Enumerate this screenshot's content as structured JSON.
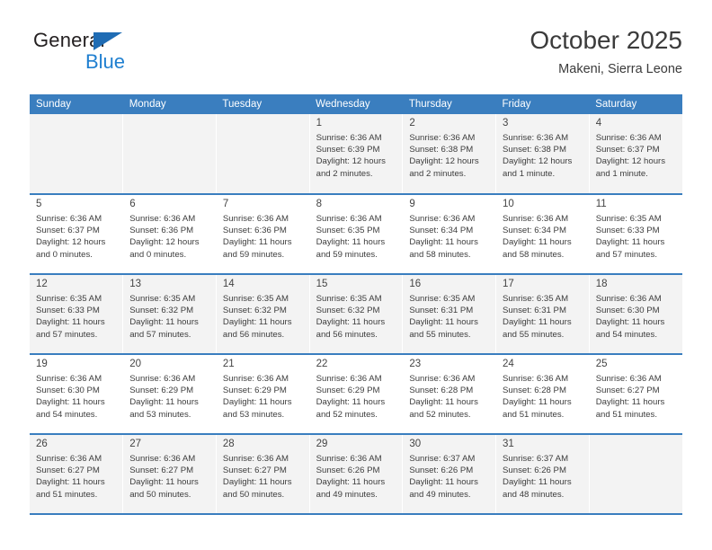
{
  "brand": {
    "line1": "General",
    "line2": "Blue",
    "triangle_icon": "blue-triangle-logo-mark",
    "color_dark": "#231f20",
    "color_blue": "#1f7fd0",
    "triangle_color": "#1f6cb4"
  },
  "header": {
    "title": "October 2025",
    "subtitle": "Makeni, Sierra Leone"
  },
  "theme": {
    "header_row_bg": "#3a7ebf",
    "header_row_text": "#ffffff",
    "row_shaded_bg": "#f3f3f3",
    "row_plain_bg": "#ffffff",
    "cell_text": "#3d3d3d",
    "daynum_text": "#444444"
  },
  "weekday_headers": [
    "Sunday",
    "Monday",
    "Tuesday",
    "Wednesday",
    "Thursday",
    "Friday",
    "Saturday"
  ],
  "labels": {
    "sunrise": "Sunrise:",
    "sunset": "Sunset:",
    "daylight": "Daylight:"
  },
  "weeks": [
    [
      {
        "day": "",
        "sunrise": "",
        "sunset": "",
        "daylight_l1": "",
        "daylight_l2": "",
        "blank": true
      },
      {
        "day": "",
        "sunrise": "",
        "sunset": "",
        "daylight_l1": "",
        "daylight_l2": "",
        "blank": true
      },
      {
        "day": "",
        "sunrise": "",
        "sunset": "",
        "daylight_l1": "",
        "daylight_l2": "",
        "blank": true
      },
      {
        "day": "1",
        "sunrise": "Sunrise: 6:36 AM",
        "sunset": "Sunset: 6:39 PM",
        "daylight_l1": "Daylight: 12 hours",
        "daylight_l2": "and 2 minutes.",
        "blank": false
      },
      {
        "day": "2",
        "sunrise": "Sunrise: 6:36 AM",
        "sunset": "Sunset: 6:38 PM",
        "daylight_l1": "Daylight: 12 hours",
        "daylight_l2": "and 2 minutes.",
        "blank": false
      },
      {
        "day": "3",
        "sunrise": "Sunrise: 6:36 AM",
        "sunset": "Sunset: 6:38 PM",
        "daylight_l1": "Daylight: 12 hours",
        "daylight_l2": "and 1 minute.",
        "blank": false
      },
      {
        "day": "4",
        "sunrise": "Sunrise: 6:36 AM",
        "sunset": "Sunset: 6:37 PM",
        "daylight_l1": "Daylight: 12 hours",
        "daylight_l2": "and 1 minute.",
        "blank": false
      }
    ],
    [
      {
        "day": "5",
        "sunrise": "Sunrise: 6:36 AM",
        "sunset": "Sunset: 6:37 PM",
        "daylight_l1": "Daylight: 12 hours",
        "daylight_l2": "and 0 minutes.",
        "blank": false
      },
      {
        "day": "6",
        "sunrise": "Sunrise: 6:36 AM",
        "sunset": "Sunset: 6:36 PM",
        "daylight_l1": "Daylight: 12 hours",
        "daylight_l2": "and 0 minutes.",
        "blank": false
      },
      {
        "day": "7",
        "sunrise": "Sunrise: 6:36 AM",
        "sunset": "Sunset: 6:36 PM",
        "daylight_l1": "Daylight: 11 hours",
        "daylight_l2": "and 59 minutes.",
        "blank": false
      },
      {
        "day": "8",
        "sunrise": "Sunrise: 6:36 AM",
        "sunset": "Sunset: 6:35 PM",
        "daylight_l1": "Daylight: 11 hours",
        "daylight_l2": "and 59 minutes.",
        "blank": false
      },
      {
        "day": "9",
        "sunrise": "Sunrise: 6:36 AM",
        "sunset": "Sunset: 6:34 PM",
        "daylight_l1": "Daylight: 11 hours",
        "daylight_l2": "and 58 minutes.",
        "blank": false
      },
      {
        "day": "10",
        "sunrise": "Sunrise: 6:36 AM",
        "sunset": "Sunset: 6:34 PM",
        "daylight_l1": "Daylight: 11 hours",
        "daylight_l2": "and 58 minutes.",
        "blank": false
      },
      {
        "day": "11",
        "sunrise": "Sunrise: 6:35 AM",
        "sunset": "Sunset: 6:33 PM",
        "daylight_l1": "Daylight: 11 hours",
        "daylight_l2": "and 57 minutes.",
        "blank": false
      }
    ],
    [
      {
        "day": "12",
        "sunrise": "Sunrise: 6:35 AM",
        "sunset": "Sunset: 6:33 PM",
        "daylight_l1": "Daylight: 11 hours",
        "daylight_l2": "and 57 minutes.",
        "blank": false
      },
      {
        "day": "13",
        "sunrise": "Sunrise: 6:35 AM",
        "sunset": "Sunset: 6:32 PM",
        "daylight_l1": "Daylight: 11 hours",
        "daylight_l2": "and 57 minutes.",
        "blank": false
      },
      {
        "day": "14",
        "sunrise": "Sunrise: 6:35 AM",
        "sunset": "Sunset: 6:32 PM",
        "daylight_l1": "Daylight: 11 hours",
        "daylight_l2": "and 56 minutes.",
        "blank": false
      },
      {
        "day": "15",
        "sunrise": "Sunrise: 6:35 AM",
        "sunset": "Sunset: 6:32 PM",
        "daylight_l1": "Daylight: 11 hours",
        "daylight_l2": "and 56 minutes.",
        "blank": false
      },
      {
        "day": "16",
        "sunrise": "Sunrise: 6:35 AM",
        "sunset": "Sunset: 6:31 PM",
        "daylight_l1": "Daylight: 11 hours",
        "daylight_l2": "and 55 minutes.",
        "blank": false
      },
      {
        "day": "17",
        "sunrise": "Sunrise: 6:35 AM",
        "sunset": "Sunset: 6:31 PM",
        "daylight_l1": "Daylight: 11 hours",
        "daylight_l2": "and 55 minutes.",
        "blank": false
      },
      {
        "day": "18",
        "sunrise": "Sunrise: 6:36 AM",
        "sunset": "Sunset: 6:30 PM",
        "daylight_l1": "Daylight: 11 hours",
        "daylight_l2": "and 54 minutes.",
        "blank": false
      }
    ],
    [
      {
        "day": "19",
        "sunrise": "Sunrise: 6:36 AM",
        "sunset": "Sunset: 6:30 PM",
        "daylight_l1": "Daylight: 11 hours",
        "daylight_l2": "and 54 minutes.",
        "blank": false
      },
      {
        "day": "20",
        "sunrise": "Sunrise: 6:36 AM",
        "sunset": "Sunset: 6:29 PM",
        "daylight_l1": "Daylight: 11 hours",
        "daylight_l2": "and 53 minutes.",
        "blank": false
      },
      {
        "day": "21",
        "sunrise": "Sunrise: 6:36 AM",
        "sunset": "Sunset: 6:29 PM",
        "daylight_l1": "Daylight: 11 hours",
        "daylight_l2": "and 53 minutes.",
        "blank": false
      },
      {
        "day": "22",
        "sunrise": "Sunrise: 6:36 AM",
        "sunset": "Sunset: 6:29 PM",
        "daylight_l1": "Daylight: 11 hours",
        "daylight_l2": "and 52 minutes.",
        "blank": false
      },
      {
        "day": "23",
        "sunrise": "Sunrise: 6:36 AM",
        "sunset": "Sunset: 6:28 PM",
        "daylight_l1": "Daylight: 11 hours",
        "daylight_l2": "and 52 minutes.",
        "blank": false
      },
      {
        "day": "24",
        "sunrise": "Sunrise: 6:36 AM",
        "sunset": "Sunset: 6:28 PM",
        "daylight_l1": "Daylight: 11 hours",
        "daylight_l2": "and 51 minutes.",
        "blank": false
      },
      {
        "day": "25",
        "sunrise": "Sunrise: 6:36 AM",
        "sunset": "Sunset: 6:27 PM",
        "daylight_l1": "Daylight: 11 hours",
        "daylight_l2": "and 51 minutes.",
        "blank": false
      }
    ],
    [
      {
        "day": "26",
        "sunrise": "Sunrise: 6:36 AM",
        "sunset": "Sunset: 6:27 PM",
        "daylight_l1": "Daylight: 11 hours",
        "daylight_l2": "and 51 minutes.",
        "blank": false
      },
      {
        "day": "27",
        "sunrise": "Sunrise: 6:36 AM",
        "sunset": "Sunset: 6:27 PM",
        "daylight_l1": "Daylight: 11 hours",
        "daylight_l2": "and 50 minutes.",
        "blank": false
      },
      {
        "day": "28",
        "sunrise": "Sunrise: 6:36 AM",
        "sunset": "Sunset: 6:27 PM",
        "daylight_l1": "Daylight: 11 hours",
        "daylight_l2": "and 50 minutes.",
        "blank": false
      },
      {
        "day": "29",
        "sunrise": "Sunrise: 6:36 AM",
        "sunset": "Sunset: 6:26 PM",
        "daylight_l1": "Daylight: 11 hours",
        "daylight_l2": "and 49 minutes.",
        "blank": false
      },
      {
        "day": "30",
        "sunrise": "Sunrise: 6:37 AM",
        "sunset": "Sunset: 6:26 PM",
        "daylight_l1": "Daylight: 11 hours",
        "daylight_l2": "and 49 minutes.",
        "blank": false
      },
      {
        "day": "31",
        "sunrise": "Sunrise: 6:37 AM",
        "sunset": "Sunset: 6:26 PM",
        "daylight_l1": "Daylight: 11 hours",
        "daylight_l2": "and 48 minutes.",
        "blank": false
      },
      {
        "day": "",
        "sunrise": "",
        "sunset": "",
        "daylight_l1": "",
        "daylight_l2": "",
        "blank": true
      }
    ]
  ]
}
